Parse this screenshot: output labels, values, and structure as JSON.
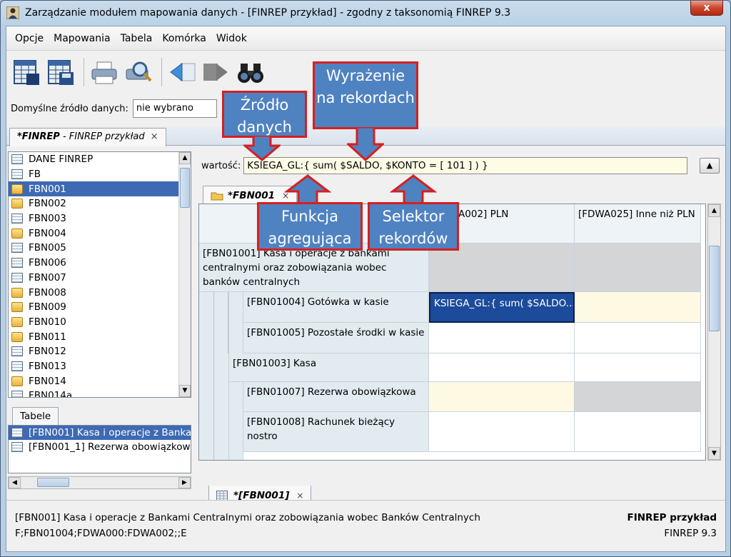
{
  "window": {
    "title": "Zarządzanie modułem mapowania danych - [FINREP przykład] - zgodny z taksonomią FINREP 9.3",
    "close_glyph": "x"
  },
  "menu": {
    "items": [
      {
        "label": "Opcje"
      },
      {
        "label": "Mapowania"
      },
      {
        "label": "Tabela"
      },
      {
        "label": "Komórka"
      },
      {
        "label": "Widok"
      }
    ]
  },
  "toolbar": {
    "buttons": [
      "table-open-icon",
      "table-save-icon",
      "print-icon",
      "print-preview-icon",
      "back-arrow-icon",
      "forward-arrow-icon",
      "binoculars-icon"
    ]
  },
  "source": {
    "label": "Domyślne źródło danych:",
    "value": "nie wybrano"
  },
  "doc_tab": {
    "name": "*FINREP",
    "suffix": " - FINREP przykład",
    "close": "×"
  },
  "tree": {
    "items": [
      {
        "label": "DANE FINREP",
        "icon": "grid",
        "selected": false
      },
      {
        "label": "FB",
        "icon": "grid",
        "selected": false
      },
      {
        "label": "FBN001",
        "icon": "folder",
        "selected": true
      },
      {
        "label": "FBN002",
        "icon": "folder",
        "selected": false
      },
      {
        "label": "FBN003",
        "icon": "grid",
        "selected": false
      },
      {
        "label": "FBN004",
        "icon": "folder",
        "selected": false
      },
      {
        "label": "FBN005",
        "icon": "grid",
        "selected": false
      },
      {
        "label": "FBN006",
        "icon": "grid",
        "selected": false
      },
      {
        "label": "FBN007",
        "icon": "grid",
        "selected": false
      },
      {
        "label": "FBN008",
        "icon": "folder",
        "selected": false
      },
      {
        "label": "FBN009",
        "icon": "folder",
        "selected": false
      },
      {
        "label": "FBN010",
        "icon": "folder",
        "selected": false
      },
      {
        "label": "FBN011",
        "icon": "folder",
        "selected": false
      },
      {
        "label": "FBN012",
        "icon": "grid",
        "selected": false
      },
      {
        "label": "FBN013",
        "icon": "grid",
        "selected": false
      },
      {
        "label": "FBN014",
        "icon": "folder",
        "selected": false
      },
      {
        "label": "FBN014a",
        "icon": "grid",
        "selected": false
      }
    ]
  },
  "tables": {
    "tab_label": "Tabele",
    "items": [
      {
        "label": "[FBN001] Kasa i operacje z Banka",
        "selected": true
      },
      {
        "label": "[FBN001_1] Rezerwa obowiązkow",
        "selected": false
      }
    ]
  },
  "value_field": {
    "label": "wartość:",
    "value": "KSIEGA_GL:{ sum( $SALDO, $KONTO = [ 101 ] ) }",
    "up_button": "▲"
  },
  "sheet": {
    "tab_label": "*FBN001",
    "close": "×",
    "col_headers": [
      "[FDWA002] PLN",
      "[FDWA025] Inne niż PLN"
    ],
    "rows": [
      {
        "label": "[FBN01001] Kasa i operacje z bankami centralnymi oraz zobowiązania wobec banków centralnych"
      },
      {
        "label": "[FBN01004] Gotówka w kasie"
      },
      {
        "label": "[FBN01005] Pozostałe środki w kasie"
      },
      {
        "label": "[FBN01003] Kasa"
      },
      {
        "label": "[FBN01007] Rezerwa obowiązkowa"
      },
      {
        "label": "[FBN01008] Rachunek bieżący nostro"
      }
    ],
    "selected_cell": "KSIEGA_GL:{ sum( $SALDO..."
  },
  "bottom_tab": {
    "label": "*[FBN001]",
    "close": "×"
  },
  "status": {
    "line1": "[FBN001] Kasa i operacje z Bankami Centralnymi oraz zobowiązania wobec Banków Centralnych",
    "line2": "F;FBN01004;FDWA000:FDWA002;;E",
    "right1": "FINREP przykład",
    "right2": "FINREP 9.3"
  },
  "callouts": {
    "zrodlo": "Źródło danych",
    "wyrazenie": "Wyrażenie na rekordach",
    "funkcja": "Funkcja agregująca",
    "selektor": "Selektor rekordów"
  },
  "colors": {
    "callout_fill": "#4f82c1",
    "callout_border": "#d71f1f",
    "selection": "#3e6ab3"
  }
}
